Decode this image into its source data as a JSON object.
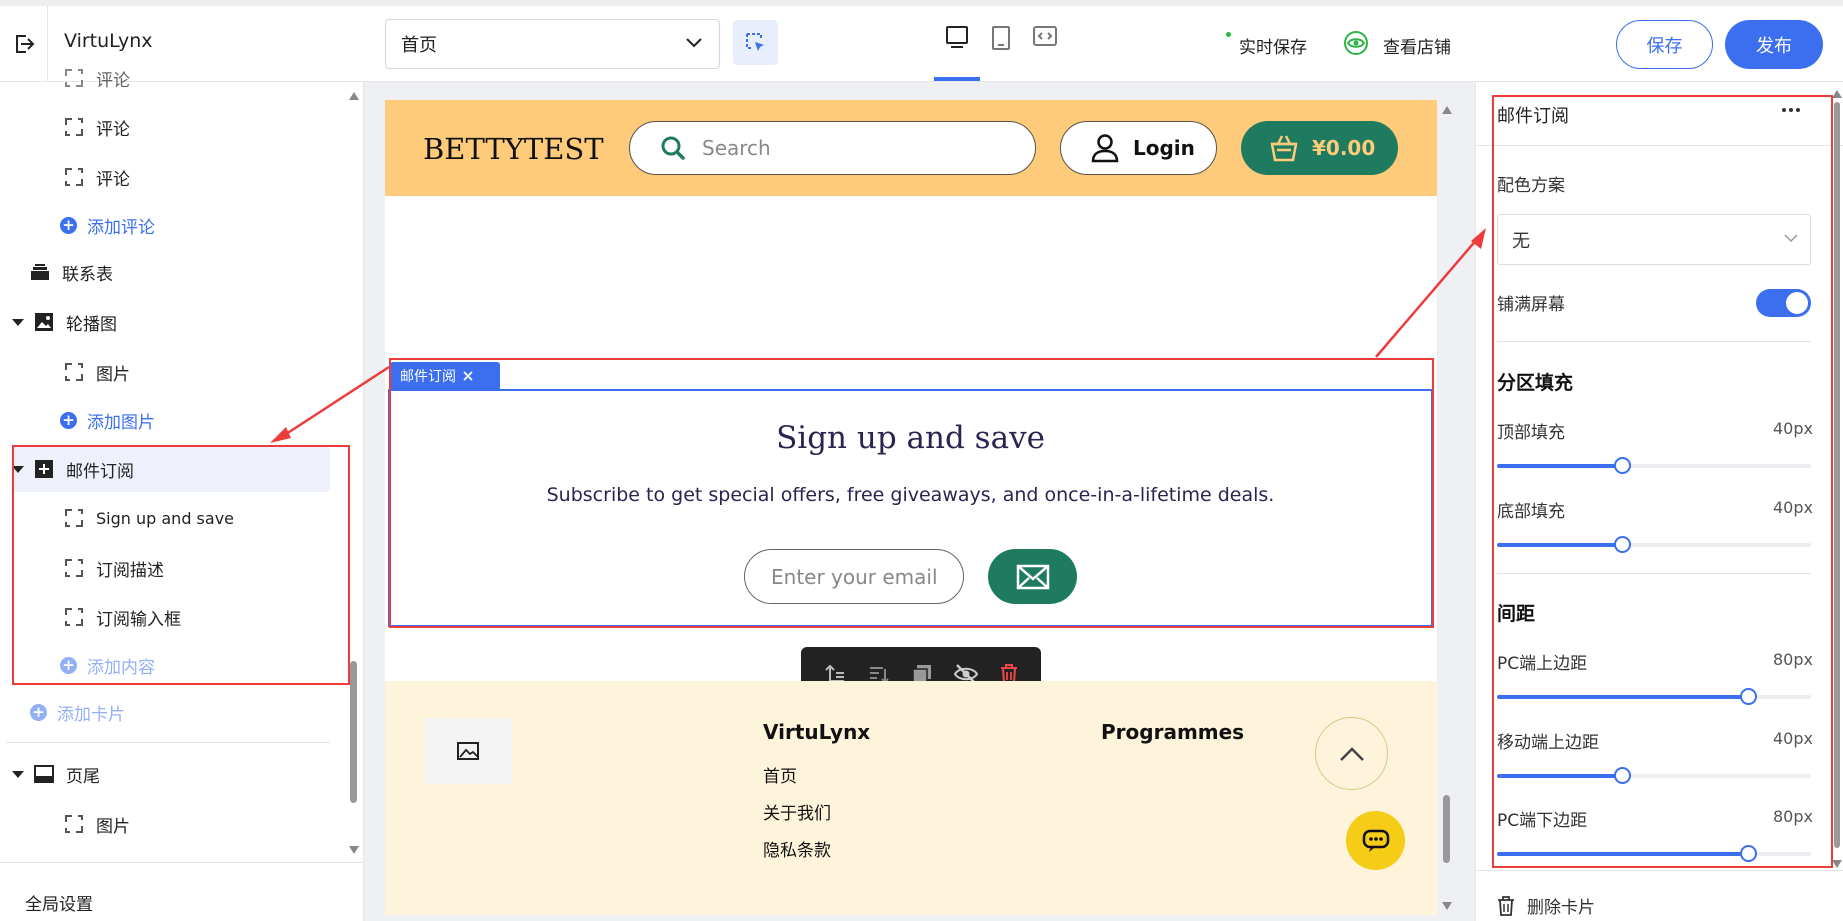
{
  "topbar": {
    "exit_icon": "exit-icon",
    "site_name": "VirtuLynx",
    "page_select": "首页",
    "save_status": "实时保存",
    "view_store": "查看店铺",
    "save_button": "保存",
    "publish_button": "发布"
  },
  "left": {
    "items": [
      {
        "label": "评论"
      },
      {
        "label": "评论"
      },
      {
        "label": "评论"
      },
      {
        "label": "添加评论"
      },
      {
        "label": "联系表"
      },
      {
        "label": "轮播图"
      },
      {
        "label": "图片"
      },
      {
        "label": "添加图片"
      },
      {
        "label": "邮件订阅"
      },
      {
        "label": "Sign up and save"
      },
      {
        "label": "订阅描述"
      },
      {
        "label": "订阅输入框"
      },
      {
        "label": "添加内容"
      },
      {
        "label": "添加卡片"
      },
      {
        "label": "页尾"
      },
      {
        "label": "图片"
      }
    ],
    "global_settings": "全局设置"
  },
  "canvas": {
    "header": {
      "brand": "BETTYTEST",
      "search_placeholder": "Search",
      "login": "Login",
      "cart": "¥0.00",
      "bg_color": "#fdcb7a",
      "accent_color": "#1e7b5f"
    },
    "section_tag": "邮件订阅",
    "subscribe": {
      "title": "Sign up and save",
      "description": "Subscribe to get special offers, free giveaways, and once-in-a-lifetime deals.",
      "email_placeholder": "Enter your email"
    },
    "toolbar_icons": [
      "move-up-icon",
      "move-down-icon",
      "copy-icon",
      "hide-icon",
      "delete-icon"
    ],
    "footer": {
      "col1_title": "VirtuLynx",
      "col1_links": [
        "首页",
        "关于我们",
        "隐私条款"
      ],
      "col2_title": "Programmes"
    }
  },
  "right": {
    "panel_title": "邮件订阅",
    "color_scheme_label": "配色方案",
    "color_scheme_value": "无",
    "fullscreen_label": "铺满屏幕",
    "fullscreen_on": true,
    "padding_section": "分区填充",
    "top_padding_label": "顶部填充",
    "top_padding_value": "40px",
    "bottom_padding_label": "底部填充",
    "bottom_padding_value": "40px",
    "spacing_section": "间距",
    "pc_top_label": "PC端上边距",
    "pc_top_value": "80px",
    "mobile_top_label": "移动端上边距",
    "mobile_top_value": "40px",
    "pc_bottom_label": "PC端下边距",
    "pc_bottom_value": "80px",
    "delete_card": "删除卡片"
  }
}
